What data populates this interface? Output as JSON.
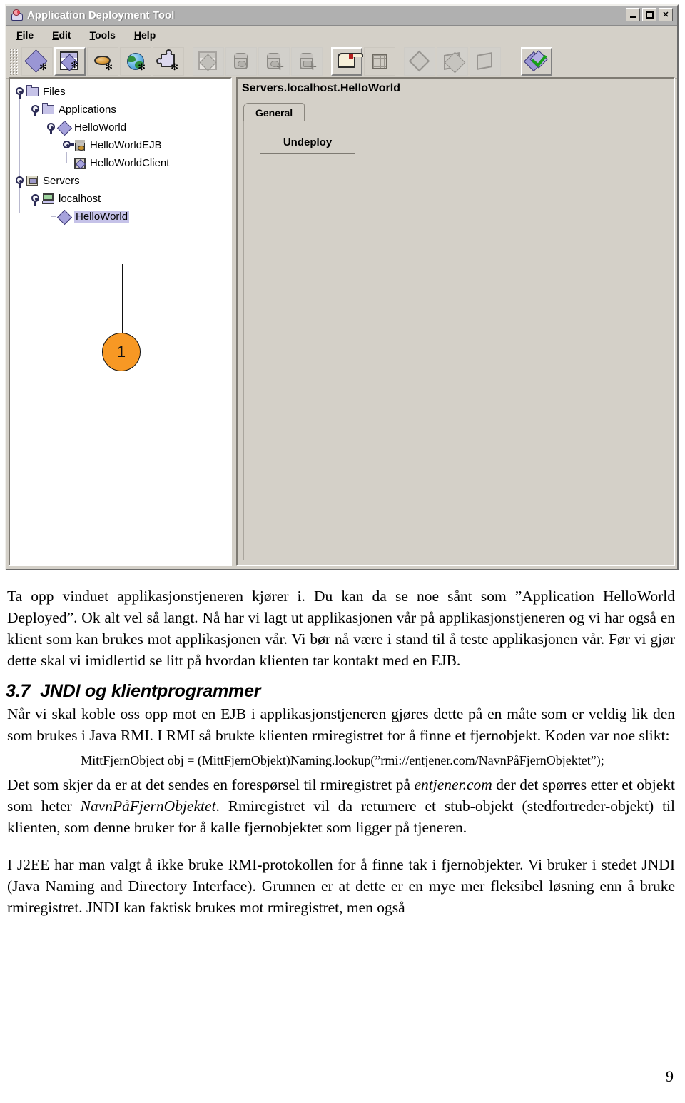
{
  "window": {
    "title": "Application Deployment Tool",
    "icon": "duke-coffee-icon",
    "buttons": {
      "minimize": "_",
      "maximize": "□",
      "close": "✕"
    },
    "menu": [
      "File",
      "Edit",
      "Tools",
      "Help"
    ],
    "toolbar": {
      "group1": [
        {
          "name": "new-application-icon",
          "enabled": true
        },
        {
          "name": "new-application-file-icon",
          "enabled": true
        },
        {
          "name": "new-enterprise-bean-icon",
          "enabled": true
        },
        {
          "name": "new-web-component-icon",
          "enabled": true
        },
        {
          "name": "new-application-client-icon",
          "enabled": true
        }
      ],
      "group2": [
        {
          "name": "add-to-application-icon",
          "enabled": false
        },
        {
          "name": "add-ejb-jar-icon",
          "enabled": false
        },
        {
          "name": "add-ejb-jar-plus-icon",
          "enabled": false
        },
        {
          "name": "add-jar-module-icon",
          "enabled": false
        }
      ],
      "group3": [
        {
          "name": "open-folder-icon",
          "enabled": true
        },
        {
          "name": "grid-table-icon",
          "enabled": true
        }
      ],
      "group4": [
        {
          "name": "deploy-tag-icon",
          "enabled": false
        },
        {
          "name": "deploy-module-icon",
          "enabled": false
        },
        {
          "name": "undeploy-icon",
          "enabled": false
        }
      ],
      "group5": [
        {
          "name": "verifier-icon",
          "enabled": true
        }
      ]
    }
  },
  "tree": {
    "nodes": [
      {
        "label": "Files",
        "icon": "folder-icon",
        "depth": 0,
        "expanded": true,
        "selected": false
      },
      {
        "label": "Applications",
        "icon": "folder-icon",
        "depth": 1,
        "expanded": true,
        "selected": false
      },
      {
        "label": "HelloWorld",
        "icon": "diamond-app-icon",
        "depth": 2,
        "expanded": true,
        "selected": false
      },
      {
        "label": "HelloWorldEJB",
        "icon": "ejb-jar-icon",
        "depth": 3,
        "expanded": false,
        "selected": false
      },
      {
        "label": "HelloWorldClient",
        "icon": "client-jar-icon",
        "depth": 3,
        "expanded": null,
        "selected": false
      },
      {
        "label": "Servers",
        "icon": "servers-icon",
        "depth": 0,
        "expanded": true,
        "selected": false
      },
      {
        "label": "localhost",
        "icon": "host-icon",
        "depth": 1,
        "expanded": true,
        "selected": false
      },
      {
        "label": "HelloWorld",
        "icon": "diamond-app-icon",
        "depth": 2,
        "expanded": null,
        "selected": true
      }
    ]
  },
  "right_panel": {
    "title": "Servers.localhost.HelloWorld",
    "tabs": [
      "General"
    ],
    "active_tab": "General",
    "undeploy_button": "Undeploy"
  },
  "callout": {
    "number": "1",
    "color": "#f79824"
  },
  "doc": {
    "para1": "Ta opp vinduet applikasjonstjeneren kjører i. Du kan da se noe sånt som ”Application HelloWorld Deployed”. Ok alt vel så langt. Nå har vi lagt ut applikasjonen vår på applikasjonstjeneren og vi har også en klient som kan brukes mot applikasjonen vår. Vi bør nå være i stand til å teste applikasjonen vår. Før vi gjør dette skal vi imidlertid se litt på hvordan klienten tar kontakt med en EJB.",
    "heading_number": "3.7",
    "heading_text": "JNDI og klientprogrammer",
    "para2": "Når vi skal koble oss opp mot en EJB i applikasjonstjeneren gjøres dette på en måte som er veldig lik den som brukes i Java RMI. I RMI så brukte klienten rmiregistret for å finne et fjernobjekt. Koden var noe slikt:",
    "code": "MittFjernObject obj = (MittFjernObjekt)Naming.lookup(”rmi://entjener.com/NavnPåFjernObjektet”);",
    "para3_a": "Det som skjer da er at det sendes en forespørsel til rmiregistret på ",
    "para3_em1": "entjener.com",
    "para3_b": " der det spørres etter et objekt som heter ",
    "para3_em2": "NavnPåFjernObjektet",
    "para3_c": ". Rmiregistret vil da returnere et stub-objekt (stedfortreder-objekt) til klienten, som denne bruker for å kalle fjernobjektet som ligger på tjeneren.",
    "para4": "I J2EE har man valgt å ikke bruke RMI-protokollen for å finne tak i fjernobjekter. Vi bruker i stedet JNDI (Java Naming and Directory Interface). Grunnen er at dette er en mye mer fleksibel løsning enn å bruke rmiregistret. JNDI kan faktisk brukes mot rmiregistret, men også",
    "page_number": "9"
  }
}
